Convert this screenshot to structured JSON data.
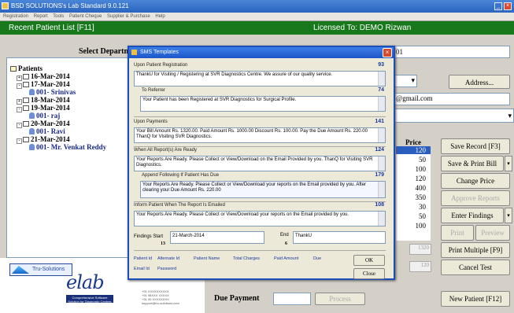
{
  "app": {
    "title": "BSD SOLUTIONS's Lab Standard 9.0.121",
    "menu": [
      "Registration",
      "Report",
      "Tools",
      "Patient Cheque",
      "Supplier & Purchase",
      "Help"
    ]
  },
  "header": {
    "left": "Recent Patient List [F11]",
    "right": "Licensed To: DEMO Rizwan"
  },
  "department_label": "Select Departme",
  "patient_tree": {
    "root": "Patients",
    "nodes": [
      {
        "label": "16-Mar-2014",
        "type": "date"
      },
      {
        "label": "17-Mar-2014",
        "type": "date"
      },
      {
        "label": "001- Srinivas",
        "type": "patient"
      },
      {
        "label": "18-Mar-2014",
        "type": "date"
      },
      {
        "label": "19-Mar-2014",
        "type": "date"
      },
      {
        "label": "001- raj",
        "type": "patient"
      },
      {
        "label": "20-Mar-2014",
        "type": "date"
      },
      {
        "label": "001- Ravi",
        "type": "patient"
      },
      {
        "label": "21-Mar-2014",
        "type": "date"
      },
      {
        "label": "001- Mr. Venkat Reddy",
        "type": "patient"
      }
    ]
  },
  "right_panel": {
    "patient_id_value": "01",
    "address_button": "Address...",
    "email_value": "@gmail.com",
    "price_header": "Price",
    "prices": [
      "120",
      "50",
      "100",
      "120",
      "400",
      "350",
      "30",
      "50",
      "100"
    ],
    "total_1": "1320",
    "total_2": "120",
    "buttons": {
      "save_record": "Save Record  [F3]",
      "save_print_bill": "Save & Print Bill",
      "change_price": "Change Price",
      "approve_reports": "Approve Reports",
      "enter_findings": "Enter Findings",
      "print": "Print",
      "preview": "Preview",
      "print_multiple": "Print Multiple  [F9]",
      "cancel_test": "Cancel Test",
      "new_patient": "New Patient [F12]"
    },
    "due_payment_label": "Due Payment",
    "process_button": "Process"
  },
  "dialog": {
    "title": "SMS Templates",
    "sections": [
      {
        "label": "Upon Patient Registration",
        "count": "93",
        "text": "ThankU for Visiting / Registering at SVR Diagnostics Centre. We assure of our quality service."
      },
      {
        "label": "To Referrer",
        "count": "74",
        "text": "Your Patient has been Registered at SVR Diagnostics for Surgical Profile."
      },
      {
        "label": "Upon Payments",
        "count": "141",
        "text": "Your Bill Amount Rs. 1320.00. Paid Amount Rs. 1000.00 Discount Rs. 100.00. Pay the Due Amount Rs. 220.00 ThanQ for Visiting SVR Diagnostics."
      },
      {
        "label": "When All Report(s) Are Ready",
        "count": "124",
        "text": "Your Reports Are Ready. Please Collect or View/Download on the Email Provided by you. ThanQ for Visiting SVR Diagnostics."
      },
      {
        "label": "Append Following If Patient Has Due",
        "count": "179",
        "text": "Your Reports Are Ready. Please Collect or View/Download your reports on the Email provided by you. After clearing your Due Amount Rs. 220.00"
      },
      {
        "label": "Inform Patient When The Report Is Emailed",
        "count": "108",
        "text": "Your Reports Are Ready. Please Collect or View/Download your reports on the Email provided by you."
      }
    ],
    "findings_start_label": "Findings Start",
    "findings_start_num": "13",
    "findings_start_value": "21-March-2014",
    "end_label": "End",
    "end_num": "6",
    "end_value": "ThankU",
    "fields": [
      "Patient Id",
      "Alternate Id",
      "Patient Name",
      "Total Charges",
      "Paid Amount",
      "Due",
      "Email Id",
      "Password"
    ],
    "ok_button": "OK",
    "close_button": "Close"
  },
  "branding": {
    "ts_logo": "Tru-Solutions",
    "elab": "elab",
    "elab_tag": "Comprehensive Software Solution for Diagnostic Centres",
    "contact": "+91 XXXXXXXXXX\n+91 98XXX XXXXX\n+91 40 XXXXXXXX\nsupport@tru-solutions.com"
  }
}
